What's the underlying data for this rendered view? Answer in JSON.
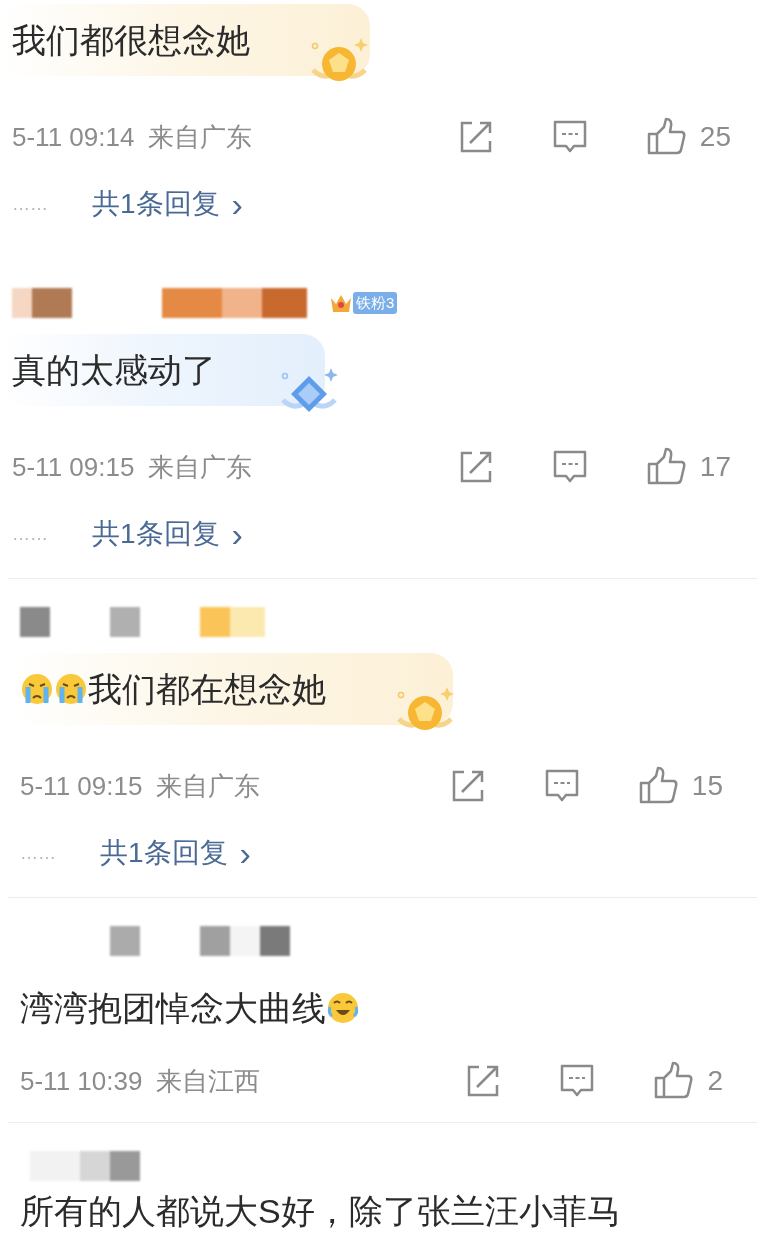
{
  "comments": [
    {
      "separated": false,
      "content": [
        {
          "kind": "text",
          "text": "我们都很想念她"
        }
      ],
      "bubble": {
        "kind": "gold"
      },
      "time": "5-11 09:14",
      "location": "来自广东",
      "likes": "25",
      "reply_dots": "……",
      "replies": "共1条回复",
      "reply_arrow": "›"
    },
    {
      "separated": false,
      "author": {
        "kind": "picture"
      },
      "fan_badge": "铁粉3",
      "content": [
        {
          "kind": "text",
          "text": "真的太感动了"
        }
      ],
      "bubble": {
        "kind": "blue"
      },
      "time": "5-11 09:15",
      "location": "来自广东",
      "likes": "17",
      "reply_dots": "……",
      "replies": "共1条回复",
      "reply_arrow": "›"
    },
    {
      "separated": true,
      "author": {
        "kind": "picture"
      },
      "content": [
        {
          "kind": "crying_emoji"
        },
        {
          "kind": "crying_emoji"
        },
        {
          "kind": "text",
          "text": "我们都在想念她"
        }
      ],
      "bubble": {
        "kind": "gold"
      },
      "time": "5-11 09:15",
      "location": "来自广东",
      "likes": "15",
      "reply_dots": "……",
      "replies": "共1条回复",
      "reply_arrow": "›"
    },
    {
      "separated": true,
      "author": {
        "kind": "picture"
      },
      "content": [
        {
          "kind": "text",
          "text": "湾湾抱团悼念大曲线"
        },
        {
          "kind": "laughing_emoji"
        }
      ],
      "time": "5-11 10:39",
      "location": "来自江西",
      "likes": "2"
    },
    {
      "separated": true,
      "author": {
        "kind": "picture"
      },
      "content": [
        {
          "kind": "text",
          "text": "所有的人都说大S好，除了张兰汪小菲马"
        }
      ]
    }
  ]
}
